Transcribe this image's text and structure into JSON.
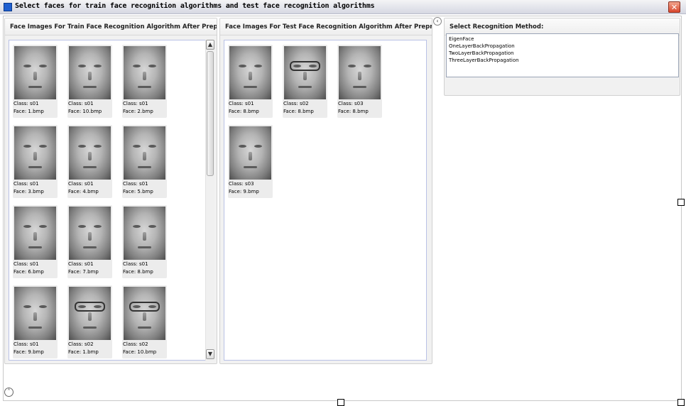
{
  "window": {
    "title": "Select faces for train face recognition algorithms and test face recognition algorithms",
    "close_glyph": "✕"
  },
  "train_panel": {
    "header": "Face Images For Train Face Recognition Algorithm After Preprocess",
    "class_prefix": "Class:",
    "face_prefix": "Face:",
    "items": [
      {
        "class": "s01",
        "face": "1.bmp",
        "glasses": false
      },
      {
        "class": "s01",
        "face": "10.bmp",
        "glasses": false
      },
      {
        "class": "s01",
        "face": "2.bmp",
        "glasses": false
      },
      {
        "class": "s01",
        "face": "3.bmp",
        "glasses": false
      },
      {
        "class": "s01",
        "face": "4.bmp",
        "glasses": false
      },
      {
        "class": "s01",
        "face": "5.bmp",
        "glasses": false
      },
      {
        "class": "s01",
        "face": "6.bmp",
        "glasses": false
      },
      {
        "class": "s01",
        "face": "7.bmp",
        "glasses": false
      },
      {
        "class": "s01",
        "face": "8.bmp",
        "glasses": false
      },
      {
        "class": "s01",
        "face": "9.bmp",
        "glasses": false
      },
      {
        "class": "s02",
        "face": "1.bmp",
        "glasses": true
      },
      {
        "class": "s02",
        "face": "10.bmp",
        "glasses": true
      }
    ]
  },
  "test_panel": {
    "header": "Face Images For Test Face Recognition Algorithm After Preprocess",
    "items": [
      {
        "class": "s01",
        "face": "8.bmp",
        "glasses": false
      },
      {
        "class": "s02",
        "face": "8.bmp",
        "glasses": true
      },
      {
        "class": "s03",
        "face": "8.bmp",
        "glasses": false
      },
      {
        "class": "s03",
        "face": "9.bmp",
        "glasses": false
      }
    ]
  },
  "method_panel": {
    "header": "Select Recognition Method:",
    "options": [
      "EigenFace",
      "OneLayerBackPropagation",
      "TwoLayerBackPropagation",
      "ThreeLayerBackPropagation"
    ]
  },
  "icons": {
    "scroll_up": "chevron-up-icon",
    "scroll_down": "chevron-down-icon",
    "collapse": "chevron-left-icon",
    "expand": "chevron-up-icon"
  }
}
